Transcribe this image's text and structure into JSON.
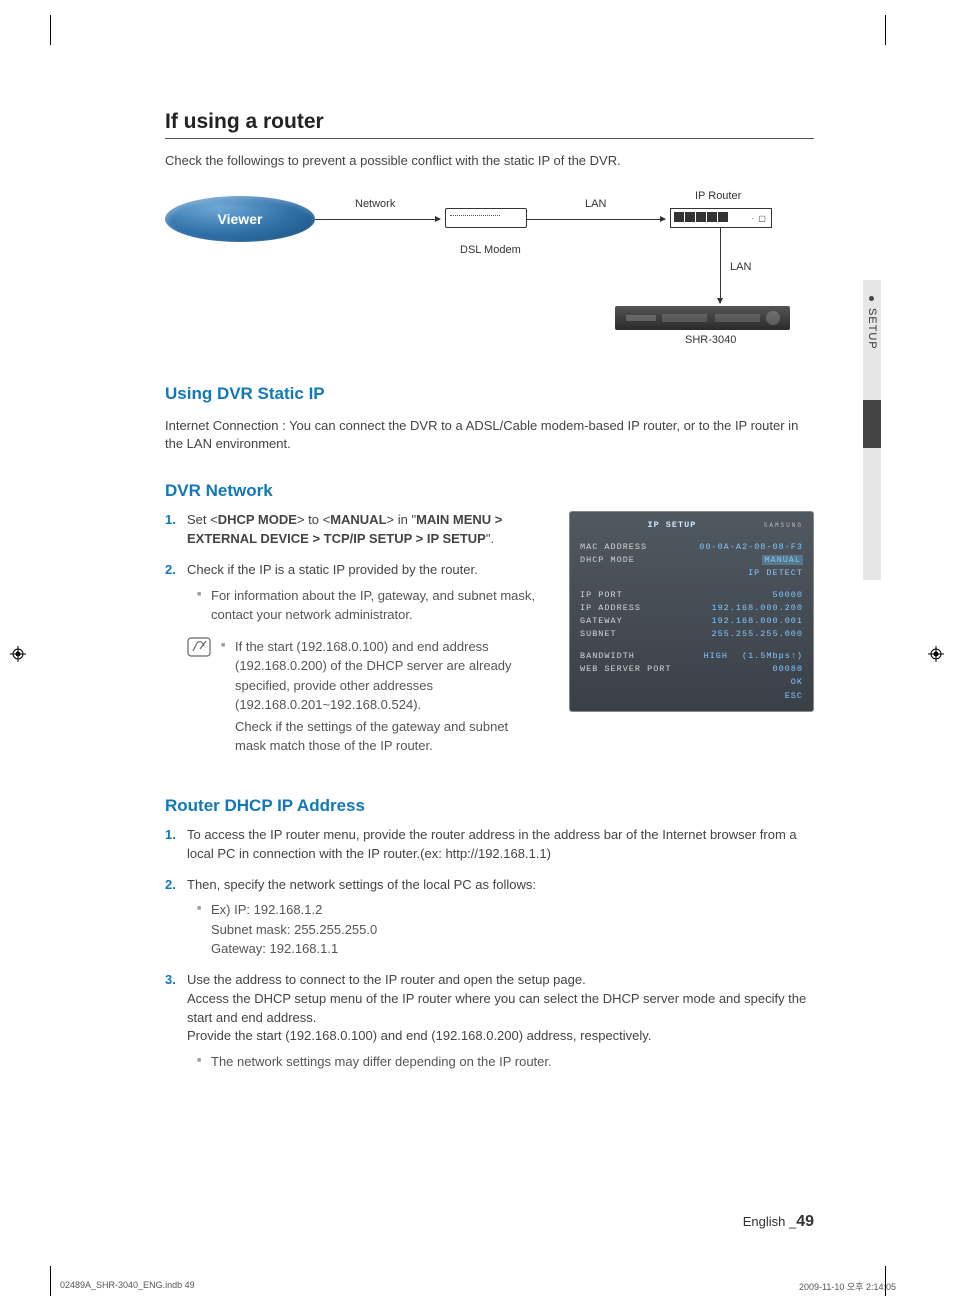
{
  "sideTab": {
    "label": "SETUP"
  },
  "h1": "If using a router",
  "intro1": "Check the followings to prevent a possible conflict with the static IP of the DVR.",
  "diagram": {
    "viewer": "Viewer",
    "network": "Network",
    "dslModem": "DSL Modem",
    "lan": "LAN",
    "ipRouter": "IP Router",
    "lan2": "LAN",
    "device": "SHR-3040"
  },
  "h2": "Using DVR Static IP",
  "para2": "Internet Connection : You can connect the DVR to a ADSL/Cable modem-based IP router, or to the IP router in the LAN environment.",
  "h3": "DVR Network",
  "dvrSteps": {
    "s1": {
      "num": "1.",
      "pre": "Set <",
      "b1": "DHCP MODE",
      "mid1": "> to <",
      "b2": "MANUAL",
      "mid2": "> in \"",
      "b3": "MAIN MENU > EXTERNAL DEVICE > TCP/IP SETUP > IP SETUP",
      "post": "\"."
    },
    "s2": {
      "num": "2.",
      "text": "Check if the IP is a static IP provided by the router.",
      "bul1": "For information about the IP, gateway, and subnet mask, contact your network administrator."
    },
    "note": {
      "b1": "If the start (192.168.0.100) and end address (192.168.0.200) of the DHCP server are already specified, provide other addresses (192.168.0.201~192.168.0.524).",
      "b2": "Check if the settings of the gateway and subnet mask match those of the IP router."
    }
  },
  "ipPanel": {
    "title": "IP SETUP",
    "brand": "SAMSUNG",
    "mac": {
      "k": "MAC ADDRESS",
      "v": "00-0A-A2-08-08-F3"
    },
    "dhcp": {
      "k": "DHCP MODE",
      "v1": "MANUAL",
      "v2": "IP DETECT"
    },
    "ipport": {
      "k": "IP PORT",
      "v": "50000"
    },
    "ipaddr": {
      "k": "IP ADDRESS",
      "v": "192.168.000.200"
    },
    "gateway": {
      "k": "GATEWAY",
      "v": "192.168.000.001"
    },
    "subnet": {
      "k": "SUBNET",
      "v": "255.255.255.000"
    },
    "bandwidth": {
      "k": "BANDWIDTH",
      "v1": "HIGH",
      "v2": "(1.5Mbps↑)"
    },
    "webport": {
      "k": "WEB SERVER PORT",
      "v": "00080"
    },
    "ok": "OK",
    "esc": "ESC"
  },
  "h4": "Router DHCP IP Address",
  "routerSteps": {
    "s1": {
      "num": "1.",
      "text": "To access the IP router menu, provide the router address in the address bar of the Internet browser from a local PC in connection with the IP router.(ex: http://192.168.1.1)"
    },
    "s2": {
      "num": "2.",
      "text": "Then, specify the network settings of the local PC as follows:",
      "b1": "Ex) IP: 192.168.1.2",
      "l2": "Subnet mask: 255.255.255.0",
      "l3": "Gateway: 192.168.1.1"
    },
    "s3": {
      "num": "3.",
      "l1": "Use the address to connect to the IP router and open the setup page.",
      "l2": "Access the DHCP setup menu of the IP router where you can select the DHCP server mode and specify the start and end address.",
      "l3": "Provide the start (192.168.0.100) and end (192.168.0.200) address, respectively.",
      "b1": "The network settings may differ depending on the IP router."
    }
  },
  "footer": {
    "lang": "English _",
    "page": "49"
  },
  "indb": {
    "file": "02489A_SHR-3040_ENG.indb   49",
    "ts": "2009-11-10   오후 2:14:05"
  }
}
